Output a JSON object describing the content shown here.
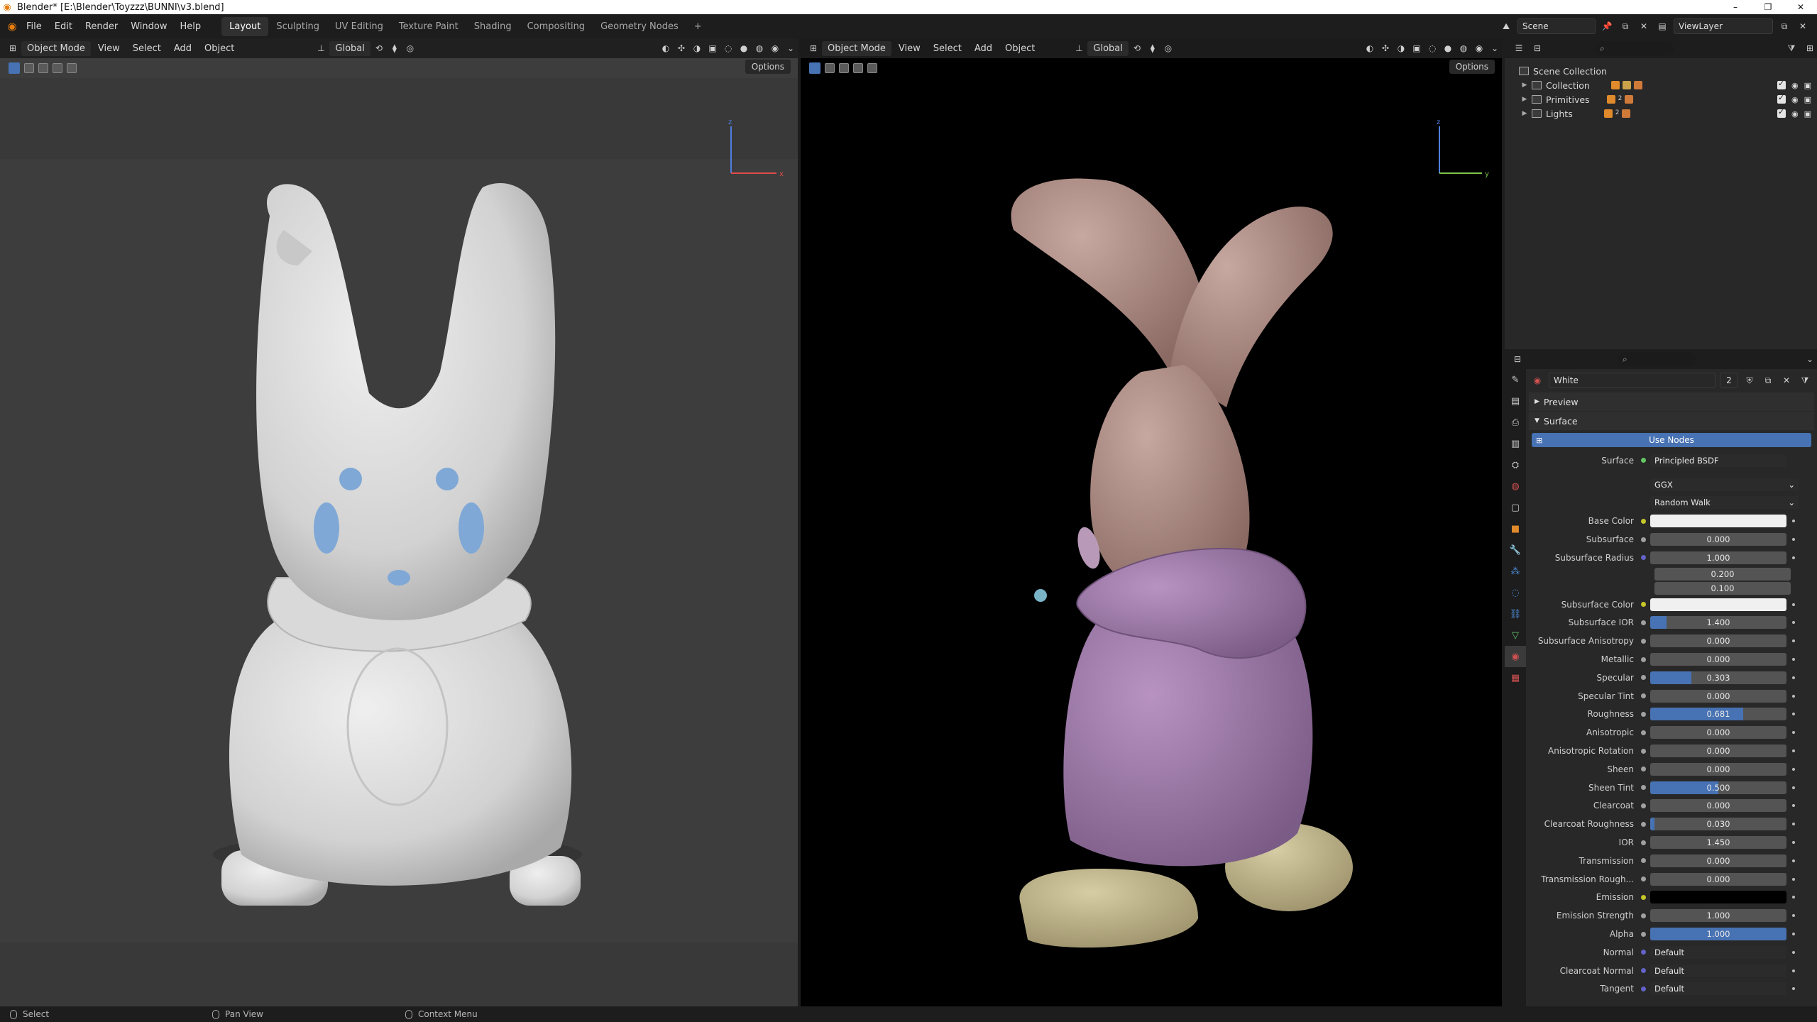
{
  "window": {
    "title": "Blender* [E:\\Blender\\Toyzzz\\BUNNI\\v3.blend]",
    "controls": [
      "–",
      "❐",
      "✕"
    ]
  },
  "menu": {
    "items": [
      "File",
      "Edit",
      "Render",
      "Window",
      "Help"
    ],
    "workspaces": [
      "Layout",
      "Sculpting",
      "UV Editing",
      "Texture Paint",
      "Shading",
      "Compositing",
      "Geometry Nodes"
    ],
    "active_workspace": "Layout",
    "add_workspace": "+",
    "scene": "Scene",
    "view_layer": "ViewLayer"
  },
  "viewport_left": {
    "mode": "Object Mode",
    "menus": [
      "View",
      "Select",
      "Add",
      "Object"
    ],
    "orientation": "Global",
    "options": "Options",
    "gizmo_axes": [
      "z",
      "x"
    ]
  },
  "viewport_right": {
    "mode": "Object Mode",
    "menus": [
      "View",
      "Select",
      "Add",
      "Object"
    ],
    "orientation": "Global",
    "options": "Options",
    "gizmo_axes": [
      "z",
      "y"
    ]
  },
  "outliner": {
    "root": "Scene Collection",
    "collections": [
      {
        "name": "Collection",
        "chip_colors": [
          "#e08a2c",
          "#c9a24a",
          "#d07a3a"
        ]
      },
      {
        "name": "Primitives",
        "chip_colors": [
          "#e08a2c",
          "#d07a3a"
        ],
        "badge": "2"
      },
      {
        "name": "Lights",
        "chip_colors": [
          "#e08a2c",
          "#d07a3a"
        ],
        "badge": "2"
      }
    ]
  },
  "properties": {
    "material_name": "White",
    "user_count": "2",
    "preview_label": "Preview",
    "surface_label": "Surface",
    "use_nodes_label": "Use Nodes",
    "surface_row": {
      "label": "Surface",
      "value": "Principled BSDF"
    },
    "distribution": "GGX",
    "subsurface_method": "Random Walk",
    "rows": [
      {
        "label": "Base Color",
        "type": "color",
        "socket": "#c7c729",
        "color": "#f0f0f0"
      },
      {
        "label": "Subsurface",
        "type": "number",
        "socket": "#a1a1a1",
        "value": "0.000",
        "fill": 0
      },
      {
        "label": "Subsurface Radius",
        "type": "vector",
        "socket": "#6363c7",
        "value": "1.000",
        "extra": [
          "0.200",
          "0.100"
        ]
      },
      {
        "label": "Subsurface Color",
        "type": "color",
        "socket": "#c7c729",
        "color": "#f0f0f0"
      },
      {
        "label": "Subsurface IOR",
        "type": "number",
        "socket": "#a1a1a1",
        "value": "1.400",
        "fill": 0.12
      },
      {
        "label": "Subsurface Anisotropy",
        "type": "number",
        "socket": "#a1a1a1",
        "value": "0.000",
        "fill": 0
      },
      {
        "label": "Metallic",
        "type": "number",
        "socket": "#a1a1a1",
        "value": "0.000",
        "fill": 0
      },
      {
        "label": "Specular",
        "type": "number",
        "socket": "#a1a1a1",
        "value": "0.303",
        "fill": 0.303
      },
      {
        "label": "Specular Tint",
        "type": "number",
        "socket": "#a1a1a1",
        "value": "0.000",
        "fill": 0
      },
      {
        "label": "Roughness",
        "type": "number",
        "socket": "#a1a1a1",
        "value": "0.681",
        "fill": 0.681
      },
      {
        "label": "Anisotropic",
        "type": "number",
        "socket": "#a1a1a1",
        "value": "0.000",
        "fill": 0
      },
      {
        "label": "Anisotropic Rotation",
        "type": "number",
        "socket": "#a1a1a1",
        "value": "0.000",
        "fill": 0
      },
      {
        "label": "Sheen",
        "type": "number",
        "socket": "#a1a1a1",
        "value": "0.000",
        "fill": 0
      },
      {
        "label": "Sheen Tint",
        "type": "number",
        "socket": "#a1a1a1",
        "value": "0.500",
        "fill": 0.5
      },
      {
        "label": "Clearcoat",
        "type": "number",
        "socket": "#a1a1a1",
        "value": "0.000",
        "fill": 0
      },
      {
        "label": "Clearcoat Roughness",
        "type": "number",
        "socket": "#a1a1a1",
        "value": "0.030",
        "fill": 0.03
      },
      {
        "label": "IOR",
        "type": "number",
        "socket": "#a1a1a1",
        "value": "1.450",
        "fill": 0
      },
      {
        "label": "Transmission",
        "type": "number",
        "socket": "#a1a1a1",
        "value": "0.000",
        "fill": 0
      },
      {
        "label": "Transmission Rough...",
        "type": "number",
        "socket": "#a1a1a1",
        "value": "0.000",
        "fill": 0
      },
      {
        "label": "Emission",
        "type": "color",
        "socket": "#c7c729",
        "color": "#000000"
      },
      {
        "label": "Emission Strength",
        "type": "number",
        "socket": "#a1a1a1",
        "value": "1.000",
        "fill": 0
      },
      {
        "label": "Alpha",
        "type": "number",
        "socket": "#a1a1a1",
        "value": "1.000",
        "fill": 1
      },
      {
        "label": "Normal",
        "type": "text",
        "socket": "#6363c7",
        "value": "Default"
      },
      {
        "label": "Clearcoat Normal",
        "type": "text",
        "socket": "#6363c7",
        "value": "Default"
      },
      {
        "label": "Tangent",
        "type": "text",
        "socket": "#6363c7",
        "value": "Default"
      }
    ]
  },
  "statusbar": {
    "select": "Select",
    "pan": "Pan View",
    "context": "Context Menu"
  },
  "colors": {
    "accent": "#4772b3",
    "blender_orange": "#e87d0d",
    "clay": "#d6d6d6",
    "bunny_skin": "#b3928a",
    "hoodie": "#a57fb0",
    "shoes": "#c3b88f",
    "eye_blue": "#7fa8d6"
  }
}
